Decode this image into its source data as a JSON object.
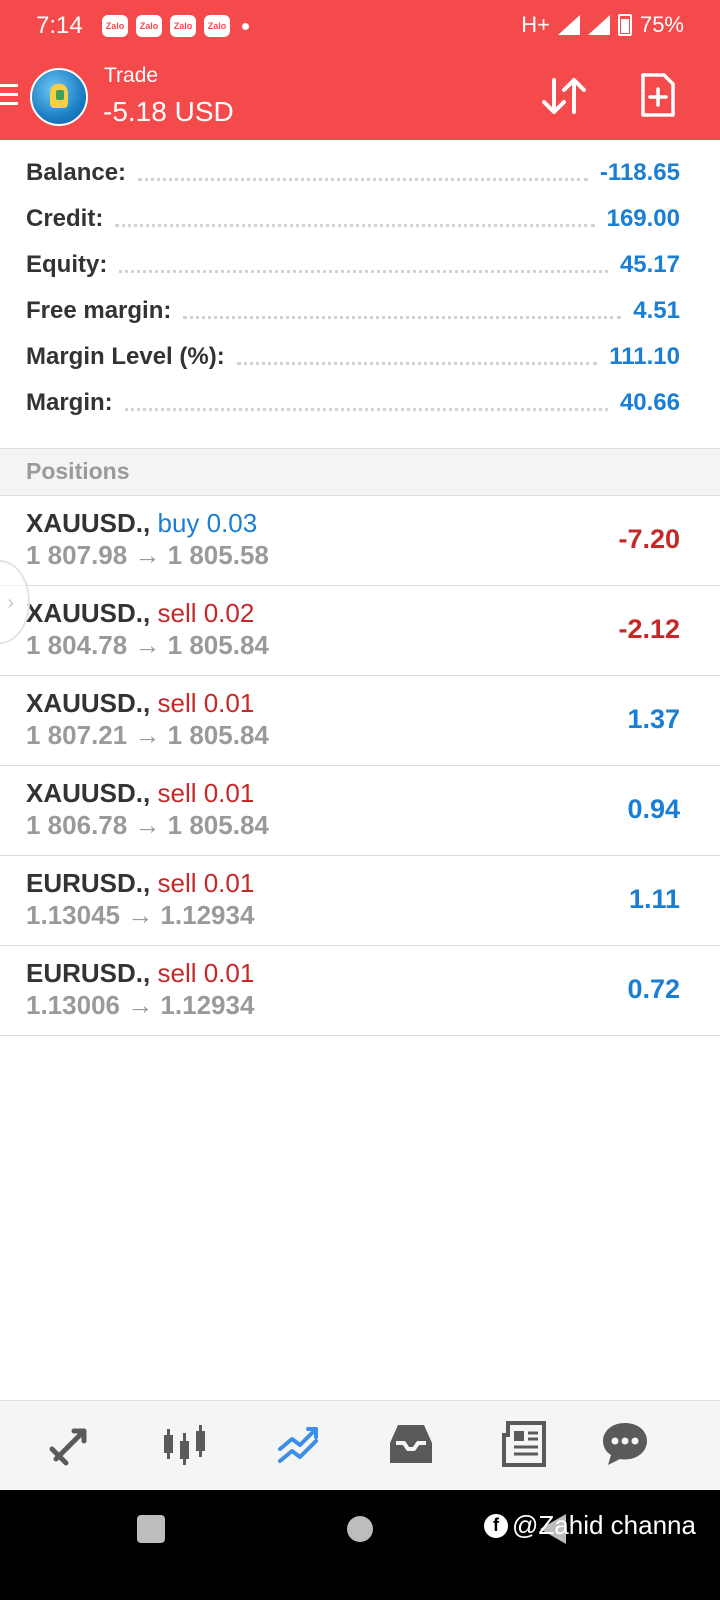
{
  "status_bar": {
    "time": "7:14",
    "notifications": [
      "Zalo",
      "Zalo",
      "Zalo",
      "Zalo"
    ],
    "network": "H+",
    "battery": "75%"
  },
  "app_bar": {
    "title": "Trade",
    "subtitle": "-5.18 USD"
  },
  "summary": [
    {
      "label": "Balance:",
      "value": "-118.65"
    },
    {
      "label": "Credit:",
      "value": "169.00"
    },
    {
      "label": "Equity:",
      "value": "45.17"
    },
    {
      "label": "Free margin:",
      "value": "4.51"
    },
    {
      "label": "Margin Level (%):",
      "value": "111.10"
    },
    {
      "label": "Margin:",
      "value": "40.66"
    }
  ],
  "positions_section": {
    "title": "Positions"
  },
  "positions": [
    {
      "symbol": "XAUUSD.,",
      "side": "buy 0.03",
      "prices": "1 807.98 → 1 805.58",
      "profit": "-7.20"
    },
    {
      "symbol": "XAUUSD.,",
      "side": "sell 0.02",
      "prices": "1 804.78 → 1 805.84",
      "profit": "-2.12"
    },
    {
      "symbol": "XAUUSD.,",
      "side": "sell 0.01",
      "prices": "1 807.21 → 1 805.84",
      "profit": "1.37"
    },
    {
      "symbol": "XAUUSD.,",
      "side": "sell 0.01",
      "prices": "1 806.78 → 1 805.84",
      "profit": "0.94"
    },
    {
      "symbol": "EURUSD.,",
      "side": "sell 0.01",
      "prices": "1.13045 → 1.12934",
      "profit": "1.11"
    },
    {
      "symbol": "EURUSD.,",
      "side": "sell 0.01",
      "prices": "1.13006 → 1.12934",
      "profit": "0.72"
    }
  ],
  "bottom_nav": {
    "items": [
      "quotes-icon",
      "chart-icon",
      "trade-icon",
      "history-icon",
      "news-icon",
      "chat-icon"
    ],
    "active": "trade-icon"
  },
  "watermark": "@Zahid channa",
  "colors": {
    "accent": "#f44a4b",
    "positive": "#1a7fd4",
    "negative": "#c62828"
  }
}
